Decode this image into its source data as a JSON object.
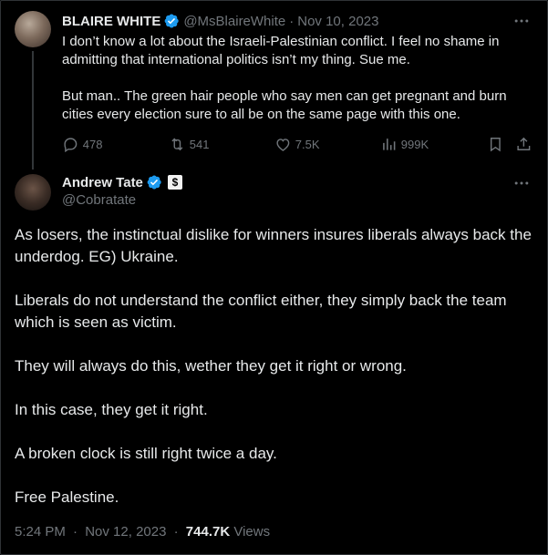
{
  "parent_tweet": {
    "author_name": "BLAIRE WHITE",
    "handle": "@MsBlaireWhite",
    "separator": "·",
    "date": "Nov 10, 2023",
    "paragraphs": [
      "I don’t know a lot about the Israeli-Palestinian conflict. I feel no shame in admitting that international politics isn’t my thing. Sue me.",
      "But man.. The green hair people who say men can get pregnant and burn cities every election sure to all be on the same page with this one."
    ],
    "actions": {
      "replies": "478",
      "reposts": "541",
      "likes": "7.5K",
      "views": "999K"
    },
    "icons": [
      "verified-badge-icon",
      "more-icon",
      "reply-icon",
      "repost-icon",
      "like-icon",
      "views-icon",
      "bookmark-icon",
      "share-icon"
    ]
  },
  "main_tweet": {
    "author_name": "Andrew Tate",
    "handle": "@Cobratate",
    "affiliate_badge": "$",
    "paragraphs": [
      "As losers, the instinctual dislike for winners insures liberals always back the underdog. EG) Ukraine.",
      "Liberals do not understand the conflict either, they simply back the team which is seen as victim.",
      "They will always do this, wether they get it right or wrong.",
      "In this case, they get it right.",
      "A broken clock is still right twice a day.",
      "Free Palestine."
    ],
    "time": "5:24 PM",
    "separator": "·",
    "date": "Nov 12, 2023",
    "views_count": "744.7K",
    "views_label": "Views"
  },
  "colors": {
    "background": "#000000",
    "text_primary": "#e7e9ea",
    "text_secondary": "#71767b",
    "verified_blue": "#1d9bf0",
    "border": "#2f3336"
  }
}
